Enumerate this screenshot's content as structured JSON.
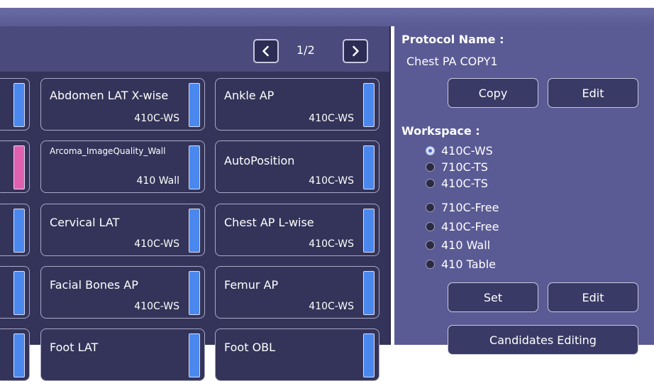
{
  "pager": {
    "page": "1/2"
  },
  "cards": [
    {
      "name": "Abdomen LAT X-wise",
      "workspace": "410C-WS",
      "color": "#4a88ee"
    },
    {
      "name": "Ankle AP",
      "workspace": "410C-WS",
      "color": "#4a88ee"
    },
    {
      "name": "Arcoma_ImageQuality_Wall",
      "workspace": "410 Wall",
      "color": "#4a88ee"
    },
    {
      "name": "AutoPosition",
      "workspace": "410C-WS",
      "color": "#4a88ee"
    },
    {
      "name": "Cervical LAT",
      "workspace": "410C-WS",
      "color": "#4a88ee"
    },
    {
      "name": "Chest AP L-wise",
      "workspace": "410C-WS",
      "color": "#4a88ee"
    },
    {
      "name": "Facial Bones AP",
      "workspace": "410C-WS",
      "color": "#4a88ee"
    },
    {
      "name": "Femur AP",
      "workspace": "410C-WS",
      "color": "#4a88ee"
    },
    {
      "name": "Foot LAT",
      "workspace": "",
      "color": "#4a88ee"
    },
    {
      "name": "Foot OBL",
      "workspace": "",
      "color": "#4a88ee"
    }
  ],
  "partial_card_colors": [
    "#4a88ee",
    "#e060b0",
    "#4a88ee",
    "#4a88ee",
    "#4a88ee"
  ],
  "protocol": {
    "label": "Protocol Name :",
    "value": "Chest PA COPY1",
    "copy_button": "Copy",
    "edit_button": "Edit"
  },
  "workspace": {
    "label": "Workspace :",
    "options": [
      "410C-WS",
      "710C-TS",
      "410C-TS",
      "710C-Free",
      "410C-Free",
      "410 Wall",
      "410 Table"
    ],
    "selected": "410C-WS",
    "set_button": "Set",
    "edit_button": "Edit"
  },
  "candidates_button": "Candidates Editing",
  "colors": {
    "panel_bg": "#34345a",
    "right_panel_bg": "#5a5a94",
    "card_bar_blue": "#4a88ee",
    "card_bar_pink": "#e060b0"
  }
}
